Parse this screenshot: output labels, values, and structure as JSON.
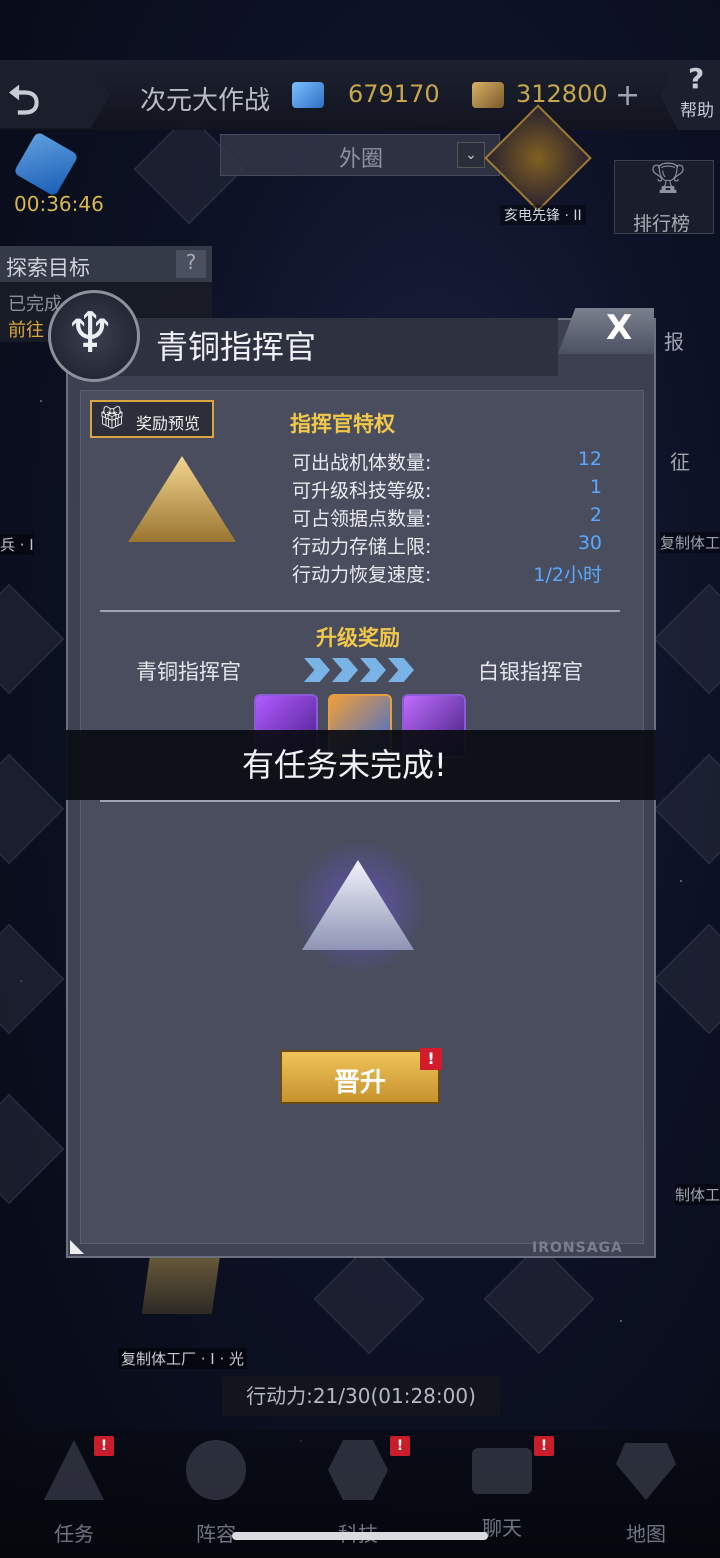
{
  "header": {
    "game_title": "次元大作战",
    "crystal_amount": "679170",
    "gold_amount": "312800",
    "help_label": "帮助"
  },
  "map": {
    "timer": "00:36:46",
    "zone_select": "外圈",
    "boss_label": "亥电先锋 · II",
    "rank_label": "排行榜",
    "side_right_1": "报",
    "side_right_2": "征",
    "side_right_3": "复制体工",
    "side_right_4": "制体工",
    "side_left_1": "兵 · I",
    "factory_label": "复制体工厂 · I · 光",
    "action_points": "行动力:21/30(01:28:00)"
  },
  "explore": {
    "title": "探索目标",
    "line1": "已完成",
    "line2": "前往"
  },
  "dialog": {
    "title": "青铜指挥官",
    "close_label": "X",
    "preview_label": "奖励预览",
    "privilege_title": "指挥官特权",
    "privileges": [
      {
        "label": "可出战机体数量:",
        "value": "12"
      },
      {
        "label": "可升级科技等级:",
        "value": "1"
      },
      {
        "label": "可占领据点数量:",
        "value": "2"
      },
      {
        "label": "行动力存储上限:",
        "value": "30"
      },
      {
        "label": "行动力恢复速度:",
        "value": "1/2小时"
      }
    ],
    "upgrade_title": "升级奖励",
    "rank_from": "青铜指挥官",
    "rank_to": "白银指挥官",
    "banner_text": "有任务未完成!",
    "promote_label": "晋升",
    "alert_mark": "!",
    "watermark": "IRONSAGA"
  },
  "nav": [
    {
      "label": "任务",
      "badge": "!"
    },
    {
      "label": "阵容",
      "badge": ""
    },
    {
      "label": "科技",
      "badge": "!"
    },
    {
      "label": "聊天",
      "badge": "!"
    },
    {
      "label": "地图",
      "badge": ""
    }
  ],
  "colors": {
    "accent_gold": "#f1c84a",
    "value_blue": "#5aa9ff",
    "alert_red": "#d21b2b"
  }
}
